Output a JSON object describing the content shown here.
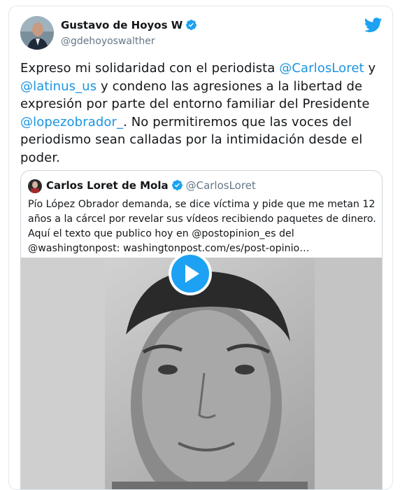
{
  "author": {
    "name": "Gustavo de Hoyos W",
    "handle": "@gdehoyoswalther"
  },
  "tweet": {
    "segments": [
      {
        "text": "Expreso mi solidaridad con el periodista ",
        "link": false
      },
      {
        "text": "@CarlosLoret",
        "link": true
      },
      {
        "text": " y ",
        "link": false
      },
      {
        "text": "@latinus_us",
        "link": true
      },
      {
        "text": " y condeno las agresiones a la libertad de expresión por parte del entorno familiar del Presidente ",
        "link": false
      },
      {
        "text": "@lopezobrador_",
        "link": true
      },
      {
        "text": ". No permitiremos que las voces del periodismo sean calladas por la intimidación desde el poder.",
        "link": false
      }
    ]
  },
  "quote": {
    "name": "Carlos Loret de Mola",
    "handle": "@CarlosLoret",
    "text": "Pío López Obrador demanda, se dice víctima y pide que me metan 12 años a la cárcel por revelar sus vídeos recibiendo paquetes de dinero. Aquí el texto que publico hoy en @postopinion_es del @washingtonpost: washingtonpost.com/es/post-opinio…"
  },
  "icons": {
    "verified": "verified-badge-icon",
    "twitter": "twitter-bird-icon",
    "play": "play-icon"
  },
  "colors": {
    "accent": "#1da1f2",
    "link": "#1b95e0",
    "muted": "#657786"
  }
}
